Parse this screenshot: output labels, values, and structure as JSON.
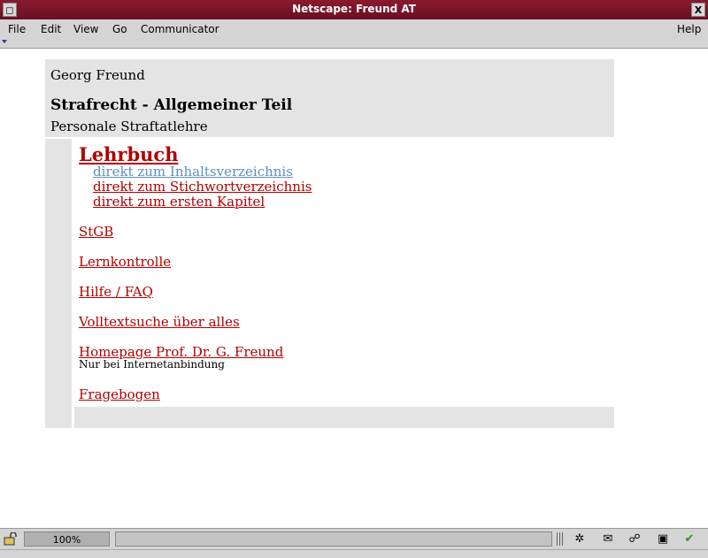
{
  "window": {
    "title": "Netscape: Freund AT",
    "left_button": "◻",
    "close_button": "X"
  },
  "menu": {
    "file": "File",
    "edit": "Edit",
    "view": "View",
    "go": "Go",
    "communicator": "Communicator",
    "help": "Help"
  },
  "header": {
    "author": "Georg Freund",
    "title": "Strafrecht - Allgemeiner Teil",
    "subtitle": "Personale Straftatlehre"
  },
  "nav": {
    "main_link": "Lehrbuch",
    "sub_links": [
      "direkt zum Inhaltsverzeichnis",
      "direkt zum Stichwortverzeichnis",
      "direkt zum ersten Kapitel"
    ],
    "stgb": "StGB",
    "lernkontrolle": "Lernkontrolle",
    "hilfe": "Hilfe / FAQ",
    "volltextsuche": "Volltextsuche über alles",
    "homepage": "Homepage Prof. Dr. G. Freund",
    "homepage_note": "Nur bei Internetanbindung",
    "fragebogen": "Fragebogen"
  },
  "status": {
    "zoom": "100%"
  },
  "colors": {
    "title_bar": "#7a1428",
    "link": "#b00000",
    "visited_link": "#5d8fbf",
    "panel": "#e4e4e4"
  },
  "icons": [
    "lock-icon",
    "navigator-icon",
    "mail-icon",
    "discussions-icon",
    "composer-icon",
    "edit-check-icon"
  ]
}
